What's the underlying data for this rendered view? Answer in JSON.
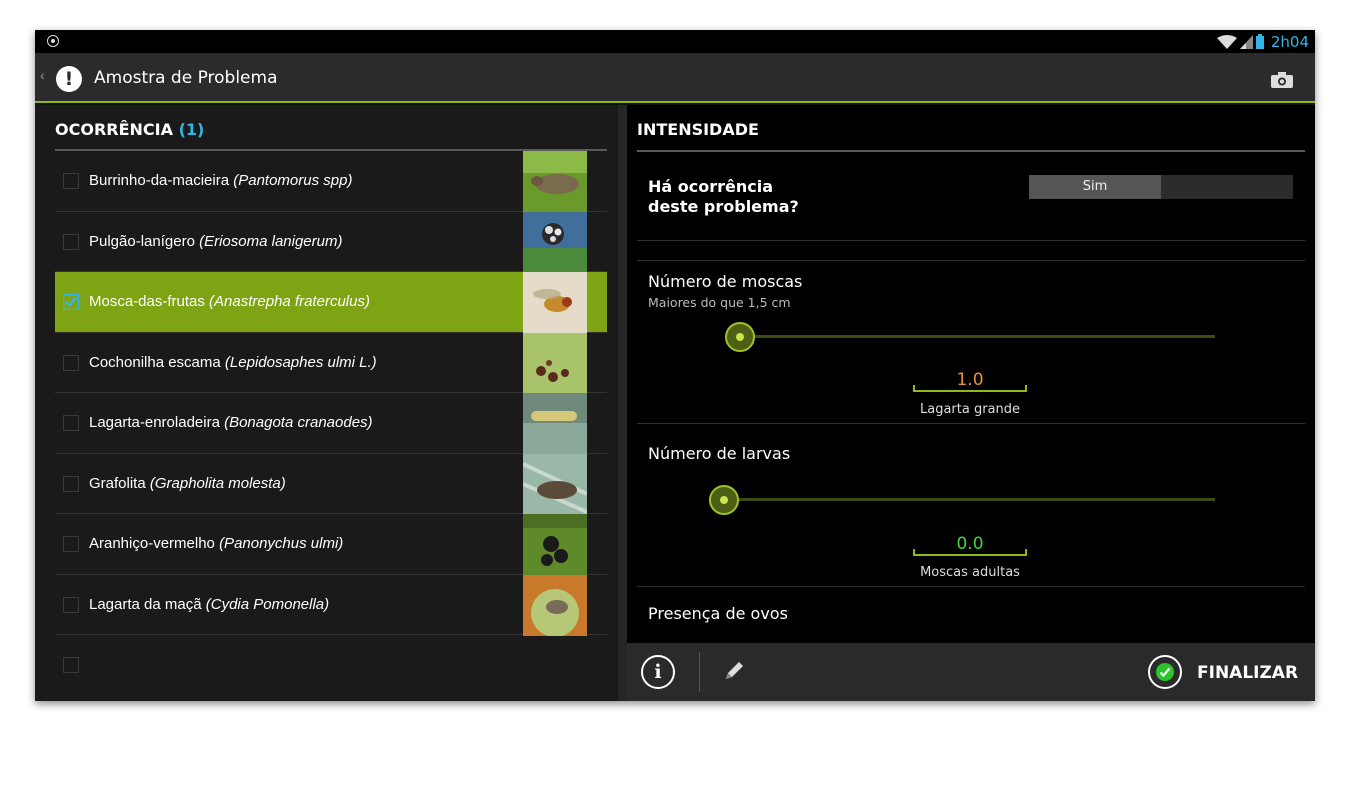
{
  "status_bar": {
    "time": "2h04",
    "icons": [
      "location-icon",
      "wifi-icon",
      "signal-icon",
      "battery-icon"
    ]
  },
  "action_bar": {
    "title": "Amostra de Problema",
    "back_icon": "chevron-left-icon",
    "alert_icon": "!",
    "camera_icon": "camera-icon"
  },
  "left_panel": {
    "header": "OCORRÊNCIA",
    "count": "(1)",
    "items": [
      {
        "name": "Burrinho-da-macieira",
        "scientific": "(Pantomorus spp)",
        "checked": false
      },
      {
        "name": "Pulgão-lanígero",
        "scientific": "(Eriosoma lanigerum)",
        "checked": false
      },
      {
        "name": "Mosca-das-frutas",
        "scientific": "(Anastrepha fraterculus)",
        "checked": true
      },
      {
        "name": "Cochonilha escama",
        "scientific": "(Lepidosaphes ulmi L.)",
        "checked": false
      },
      {
        "name": "Lagarta-enroladeira",
        "scientific": "(Bonagota cranaodes)",
        "checked": false
      },
      {
        "name": "Grafolita",
        "scientific": "(Grapholita molesta)",
        "checked": false
      },
      {
        "name": "Aranhiço-vermelho",
        "scientific": "(Panonychus ulmi)",
        "checked": false
      },
      {
        "name": "Lagarta da maçã",
        "scientific": "(Cydia Pomonella)",
        "checked": false
      }
    ]
  },
  "right_panel": {
    "header": "INTENSIDADE",
    "occurrence": {
      "question_line1": "Há ocorrência",
      "question_line2": "deste problema?",
      "selected": "Sim"
    },
    "fields": [
      {
        "title": "Número de moscas",
        "subtitle": "Maiores do que 1,5 cm",
        "value": "1.0",
        "value_label": "Lagarta grande",
        "value_color": "#e8923a",
        "slider_fraction": 0.0
      },
      {
        "title": "Número de larvas",
        "subtitle": "",
        "value": "0.0",
        "value_label": "Moscas adultas",
        "value_color": "#3fd63f",
        "slider_fraction": 0.0
      }
    ],
    "next_field_title": "Presença de ovos"
  },
  "bottom_bar": {
    "info_icon": "i",
    "finalize_label": "FINALIZAR"
  },
  "colors": {
    "accent": "#8fb81a",
    "selected_row": "#7ea413",
    "status_blue": "#33b5e5"
  }
}
